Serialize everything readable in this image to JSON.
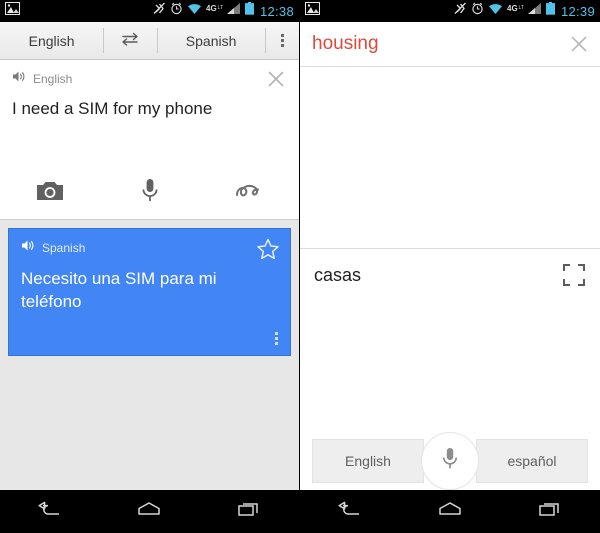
{
  "left_phone": {
    "status_bar": {
      "notification_icon": "image-icon",
      "icons": [
        "vibrate-off-icon",
        "alarm-icon",
        "wifi-icon",
        "4g-lte-icon",
        "signal-bars-icon",
        "battery-icon"
      ],
      "network_label": "4G",
      "time": "12:38"
    },
    "language_bar": {
      "source_language": "English",
      "swap_icon": "swap-arrows-icon",
      "target_language": "Spanish",
      "overflow_icon": "overflow-menu-icon"
    },
    "input_card": {
      "speaker_icon": "speaker-icon",
      "language_label": "English",
      "text": "I need a SIM for my phone",
      "clear_icon": "close-icon",
      "methods": [
        "camera-icon",
        "microphone-icon",
        "handwriting-icon"
      ]
    },
    "translation_card": {
      "speaker_icon": "speaker-icon",
      "language_label": "Spanish",
      "text": "Necesito una SIM para mi teléfono",
      "star_icon": "star-outline-icon",
      "overflow_icon": "overflow-menu-icon",
      "background_color": "#4285f4"
    }
  },
  "right_phone": {
    "status_bar": {
      "notification_icon": "image-icon",
      "icons": [
        "vibrate-off-icon",
        "alarm-icon",
        "wifi-icon",
        "4g-lte-icon",
        "signal-bars-icon",
        "battery-icon"
      ],
      "network_label": "4G",
      "time": "12:39"
    },
    "query": {
      "text": "housing",
      "color": "#dd4b3e",
      "close_icon": "close-icon"
    },
    "result": {
      "text": "casas",
      "expand_icon": "fullscreen-icon"
    },
    "bottom_bar": {
      "left_button": "English",
      "mic_icon": "microphone-icon",
      "right_button": "español"
    }
  },
  "nav_bar": {
    "back": "back-icon",
    "home": "home-icon",
    "recents": "recents-icon"
  }
}
